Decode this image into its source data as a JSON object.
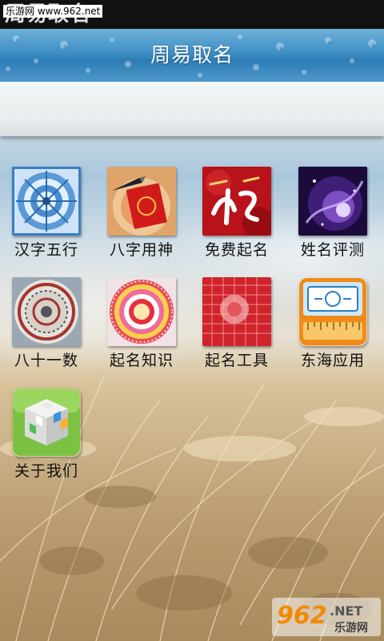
{
  "status_bar": {
    "app_name": "周易取名",
    "site_badge": "乐游网 www.962.net"
  },
  "header": {
    "title": "周易取名"
  },
  "grid": [
    {
      "label": "汉字五行",
      "icon": "bagua-compass-icon"
    },
    {
      "label": "八字用神",
      "icon": "red-envelope-icon"
    },
    {
      "label": "免费起名",
      "icon": "name-calligraphy-icon"
    },
    {
      "label": "姓名评测",
      "icon": "purple-galaxy-icon"
    },
    {
      "label": "八十一数",
      "icon": "round-disc-icon"
    },
    {
      "label": "起名知识",
      "icon": "colorful-wheel-icon"
    },
    {
      "label": "起名工具",
      "icon": "red-pattern-icon"
    },
    {
      "label": "东海应用",
      "icon": "ruler-tool-icon"
    },
    {
      "label": "关于我们",
      "icon": "cube-icon"
    }
  ],
  "watermark": {
    "number": "962",
    "suffix": ".NET",
    "sub": "乐游网"
  }
}
